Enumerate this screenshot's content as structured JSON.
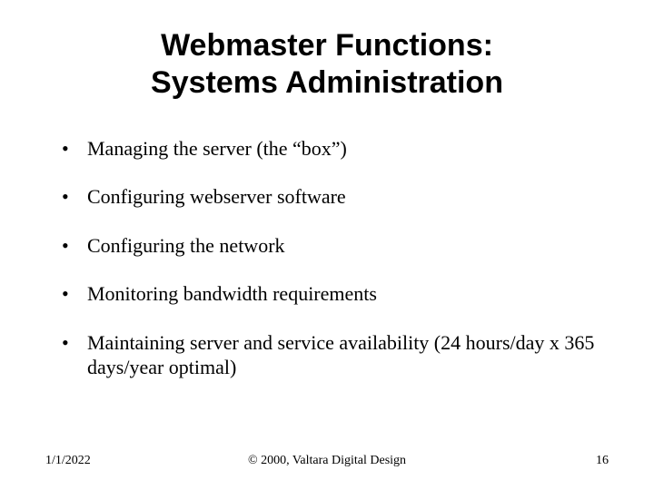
{
  "slide": {
    "title_line1": "Webmaster Functions:",
    "title_line2": "Systems Administration",
    "bullets": [
      "Managing the server (the “box”)",
      "Configuring webserver software",
      "Configuring the network",
      "Monitoring bandwidth requirements",
      "Maintaining server and service availability (24 hours/day x 365 days/year optimal)"
    ]
  },
  "footer": {
    "date": "1/1/2022",
    "copyright": "© 2000, Valtara Digital Design",
    "page_number": "16"
  }
}
